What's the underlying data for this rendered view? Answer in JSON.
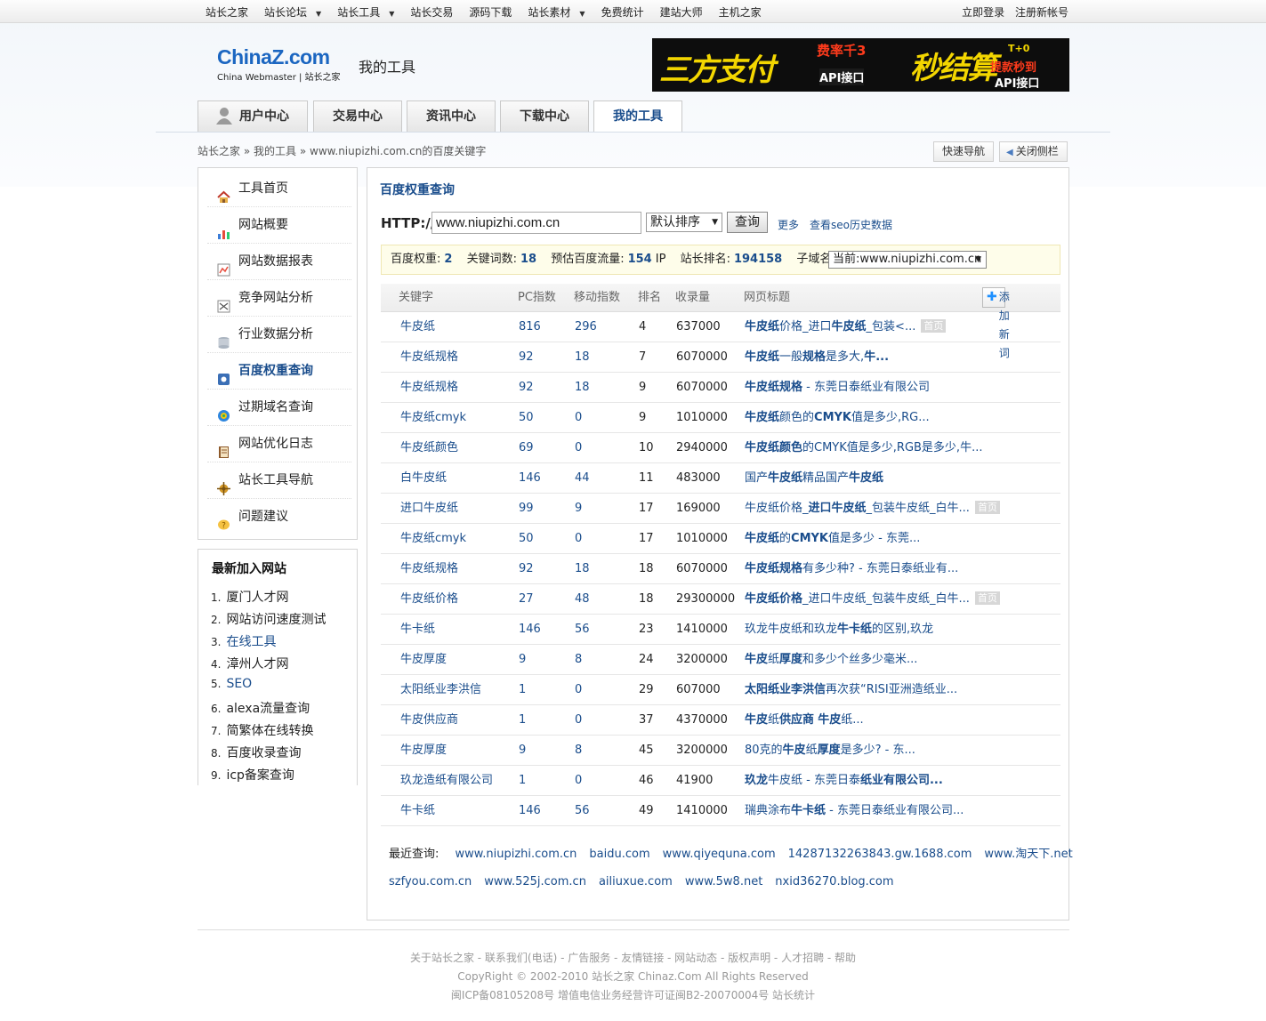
{
  "topnav": {
    "items": [
      {
        "label": "站长之家",
        "dropdown": false
      },
      {
        "label": "站长论坛",
        "dropdown": true
      },
      {
        "label": "站长工具",
        "dropdown": true
      },
      {
        "label": "站长交易",
        "dropdown": false
      },
      {
        "label": "源码下载",
        "dropdown": false
      },
      {
        "label": "站长素材",
        "dropdown": true
      },
      {
        "label": "免费统计",
        "dropdown": false
      },
      {
        "label": "建站大师",
        "dropdown": false
      },
      {
        "label": "主机之家",
        "dropdown": false
      }
    ],
    "login": "立即登录",
    "register": "注册新帐号"
  },
  "logo": {
    "main_a": "China",
    "main_z": "Z",
    "main_b": ".com",
    "sub": "China Webmaster | 站长之家"
  },
  "page_title": "我的工具",
  "banner": {
    "t1": "三方支付",
    "t2": "费率千3",
    "t2b": "API接口",
    "t3": "秒结算",
    "t4": "T+0",
    "t5": "提款秒到",
    "t6": "API接口"
  },
  "tabs": [
    "用户中心",
    "交易中心",
    "资讯中心",
    "下载中心",
    "我的工具"
  ],
  "breadcrumb": {
    "home": "站长之家",
    "sep": "»",
    "tools": "我的工具",
    "current": "www.niupizhi.com.cn的百度关键字"
  },
  "quick_nav": "快速导航",
  "close_sidebar": "关闭侧栏",
  "sidebar": {
    "items": [
      {
        "label": "工具首页",
        "icon": "home-icon"
      },
      {
        "label": "网站概要",
        "icon": "chart-icon"
      },
      {
        "label": "网站数据报表",
        "icon": "report-icon"
      },
      {
        "label": "竞争网站分析",
        "icon": "compare-icon"
      },
      {
        "label": "行业数据分析",
        "icon": "database-icon"
      },
      {
        "label": "百度权重查询",
        "icon": "weight-icon"
      },
      {
        "label": "过期域名查询",
        "icon": "domain-icon"
      },
      {
        "label": "网站优化日志",
        "icon": "book-icon"
      },
      {
        "label": "站长工具导航",
        "icon": "compass-icon"
      },
      {
        "label": "问题建议",
        "icon": "question-icon"
      }
    ]
  },
  "new_sites": {
    "title": "最新加入网站",
    "items": [
      "厦门人才网",
      "网站访问速度测试",
      "在线工具",
      "漳州人才网",
      "SEO",
      "alexa流量查询",
      "简繁体在线转换",
      "百度收录查询",
      "icp备案查询"
    ]
  },
  "main": {
    "title": "百度权重查询",
    "http_label": "HTTP://",
    "url_value": "www.niupizhi.com.cn",
    "sort_value": "默认排序",
    "query_btn": "查询",
    "more": "更多",
    "seo_history": "查看seo历史数据"
  },
  "info": {
    "weight_label": "百度权重:",
    "weight": "2",
    "kw_label": "关键词数:",
    "kw": "18",
    "flow_label": "预估百度流量:",
    "flow": "154",
    "flow_unit": "IP",
    "rank_label": "站长排名:",
    "rank": "194158",
    "sub_label": "子域名:",
    "sub_value": "当前:www.niupizhi.com.cn"
  },
  "table": {
    "headers": [
      "关键字",
      "PC指数",
      "移动指数",
      "排名",
      "收录量",
      "网页标题"
    ],
    "add_btn": "添加新词",
    "home_badge": "首页",
    "rows": [
      {
        "kw": "牛皮纸",
        "pc": "816",
        "mb": "296",
        "rk": "4",
        "sl": "637000",
        "tt": "<b>牛皮纸</b>价格_进口<b>牛皮纸</b>_包装&lt;...",
        "home": true
      },
      {
        "kw": "牛皮纸规格",
        "pc": "92",
        "mb": "18",
        "rk": "7",
        "sl": "6070000",
        "tt": "<b>牛皮纸</b>一般<b>规格</b>是多大,<b>牛...</b>",
        "home": false
      },
      {
        "kw": "牛皮纸规格",
        "pc": "92",
        "mb": "18",
        "rk": "9",
        "sl": "6070000",
        "tt": "<b>牛皮纸规格</b> - 东莞日泰纸业有限公司",
        "home": false
      },
      {
        "kw": "牛皮纸cmyk",
        "pc": "50",
        "mb": "0",
        "rk": "9",
        "sl": "1010000",
        "tt": "<b>牛皮纸</b>颜色的<b>CMYK</b>值是多少,RG...",
        "home": false
      },
      {
        "kw": "牛皮纸颜色",
        "pc": "69",
        "mb": "0",
        "rk": "10",
        "sl": "2940000",
        "tt": "<b>牛皮纸颜色</b>的CMYK值是多少,RGB是多少,牛...",
        "home": false
      },
      {
        "kw": "白牛皮纸",
        "pc": "146",
        "mb": "44",
        "rk": "11",
        "sl": "483000",
        "tt": "国产<b>牛皮纸</b>精品国产<b>牛皮纸</b>",
        "home": false
      },
      {
        "kw": "进口牛皮纸",
        "pc": "99",
        "mb": "9",
        "rk": "17",
        "sl": "169000",
        "tt": "牛皮纸价格_<b>进口牛皮纸</b>_包装牛皮纸_白牛...",
        "home": true
      },
      {
        "kw": "牛皮纸cmyk",
        "pc": "50",
        "mb": "0",
        "rk": "17",
        "sl": "1010000",
        "tt": "<b>牛皮纸</b>的<b>CMYK</b>值是多少 - 东莞...",
        "home": false
      },
      {
        "kw": "牛皮纸规格",
        "pc": "92",
        "mb": "18",
        "rk": "18",
        "sl": "6070000",
        "tt": "<b>牛皮纸规格</b>有多少种? - 东莞日泰纸业有...",
        "home": false
      },
      {
        "kw": "牛皮纸价格",
        "pc": "27",
        "mb": "48",
        "rk": "18",
        "sl": "29300000",
        "tt": "<b>牛皮纸价格</b>_进口牛皮纸_包装牛皮纸_白牛...",
        "home": true
      },
      {
        "kw": "牛卡纸",
        "pc": "146",
        "mb": "56",
        "rk": "23",
        "sl": "1410000",
        "tt": "玖龙牛皮纸和玖龙<b>牛卡纸</b>的区别,玖龙",
        "home": false
      },
      {
        "kw": "牛皮厚度",
        "pc": "9",
        "mb": "8",
        "rk": "24",
        "sl": "3200000",
        "tt": "<b>牛皮</b>纸<b>厚度</b>和多少个丝多少毫米...",
        "home": false
      },
      {
        "kw": "太阳纸业李洪信",
        "pc": "1",
        "mb": "0",
        "rk": "29",
        "sl": "607000",
        "tt": "<b>太阳纸业李洪信</b>再次获“RISI亚洲造纸业...",
        "home": false
      },
      {
        "kw": "牛皮供应商",
        "pc": "1",
        "mb": "0",
        "rk": "37",
        "sl": "4370000",
        "tt": "<b>牛皮</b>纸<b>供应商</b> <b>牛皮</b>纸...",
        "home": false
      },
      {
        "kw": "牛皮厚度",
        "pc": "9",
        "mb": "8",
        "rk": "45",
        "sl": "3200000",
        "tt": "80克的<b>牛皮</b>纸<b>厚度</b>是多少? - 东...",
        "home": false
      },
      {
        "kw": "玖龙造纸有限公司",
        "pc": "1",
        "mb": "0",
        "rk": "46",
        "sl": "41900",
        "tt": "<b>玖龙</b>牛皮纸 - 东莞日泰<b>纸业有限公司...</b>",
        "home": false
      },
      {
        "kw": "牛卡纸",
        "pc": "146",
        "mb": "56",
        "rk": "49",
        "sl": "1410000",
        "tt": "瑞典涂布<b>牛卡纸</b> - 东莞日泰纸业有限公司...",
        "home": false
      }
    ]
  },
  "recent": {
    "label": "最近查询:",
    "line1": [
      "www.niupizhi.com.cn",
      "baidu.com",
      "www.qiyequna.com",
      "14287132263843.gw.1688.com",
      "www.淘天下.net"
    ],
    "line2": [
      "szfyou.com.cn",
      "www.525j.com.cn",
      "ailiuxue.com",
      "www.5w8.net",
      "nxid36270.blog.com"
    ]
  },
  "footer": {
    "links": "关于站长之家 - 联系我们(电话) - 广告服务 - 友情链接 - 网站动态 - 版权声明 - 人才招聘 - 帮助",
    "copyright": "CopyRight © 2002-2010 站长之家 Chinaz.Com All Rights Reserved",
    "icp": "闽ICP备08105208号 增值电信业务经营许可证闽B2-20070004号 站长统计"
  }
}
